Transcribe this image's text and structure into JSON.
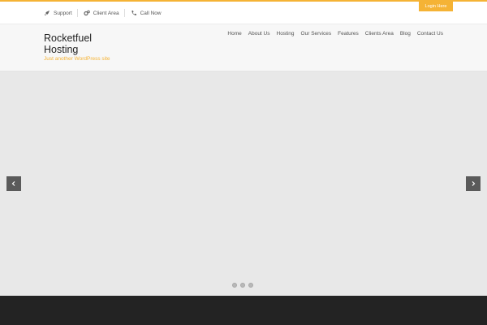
{
  "topbar": {
    "links": [
      {
        "label": "Support",
        "icon": "rocket-icon"
      },
      {
        "label": "Client Area",
        "icon": "gears-icon"
      },
      {
        "label": "Call Now",
        "icon": "phone-icon"
      }
    ],
    "login_label": "Login Here"
  },
  "header": {
    "site_title": "Rocketfuel Hosting",
    "tagline": "Just another WordPress site"
  },
  "nav": {
    "items": [
      "Home",
      "About Us",
      "Hosting",
      "Our Services",
      "Features",
      "Clients Area",
      "Blog",
      "Contact Us"
    ]
  },
  "slider": {
    "prev_icon": "chevron-left-icon",
    "next_icon": "chevron-right-icon",
    "dot_count": 3
  },
  "colors": {
    "accent": "#f5b335",
    "slider_bg": "#e8e8e8",
    "footer_bg": "#232323"
  }
}
